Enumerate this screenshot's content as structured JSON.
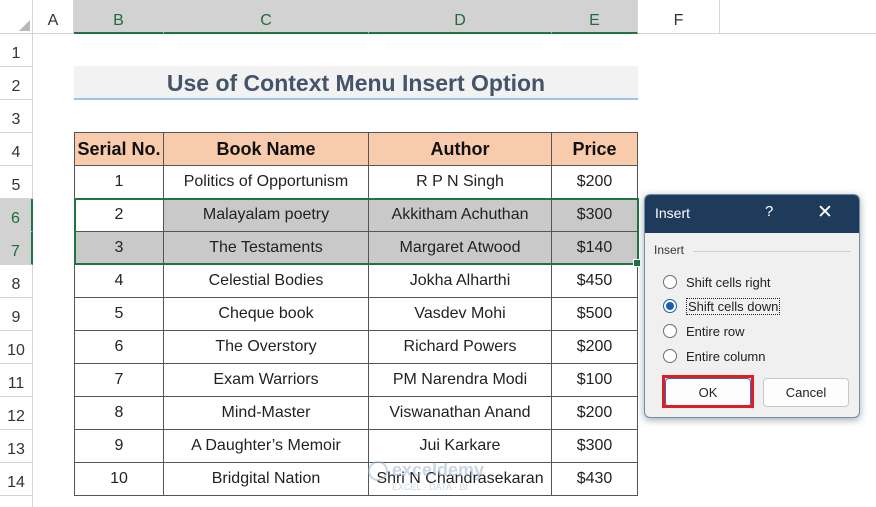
{
  "sheet": {
    "columns": [
      "A",
      "B",
      "C",
      "D",
      "E",
      "F"
    ],
    "rows": [
      "1",
      "2",
      "3",
      "4",
      "5",
      "6",
      "7",
      "8",
      "9",
      "10",
      "11",
      "12",
      "13",
      "14"
    ],
    "title": "Use  of Context Menu Insert Option",
    "headers": [
      "Serial No.",
      "Book Name",
      "Author",
      "Price"
    ],
    "data": [
      [
        "1",
        "Politics of Opportunism",
        "R P N Singh",
        "$200"
      ],
      [
        "2",
        "Malayalam poetry",
        "Akkitham Achuthan",
        "$300"
      ],
      [
        "3",
        "The Testaments",
        "Margaret Atwood",
        "$140"
      ],
      [
        "4",
        "Celestial Bodies",
        "Jokha Alharthi",
        "$450"
      ],
      [
        "5",
        "Cheque book",
        "Vasdev Mohi",
        "$500"
      ],
      [
        "6",
        "The Overstory",
        "Richard Powers",
        "$200"
      ],
      [
        "7",
        "Exam Warriors",
        "PM Narendra Modi",
        "$100"
      ],
      [
        "8",
        "Mind-Master",
        "Viswanathan Anand",
        "$200"
      ],
      [
        "9",
        "A Daughter’s Memoir",
        "Jui Karkare",
        "$300"
      ],
      [
        "10",
        "Bridgital Nation",
        "Shri N Chandrasekaran",
        "$430"
      ]
    ],
    "selected_rows": [
      "6",
      "7"
    ],
    "selected_columns": [
      "B",
      "C",
      "D",
      "E"
    ]
  },
  "watermark": {
    "name": "exceldemy",
    "tagline": "EXCEL · DATA · BI"
  },
  "dialog": {
    "title": "Insert",
    "help_icon": "?",
    "close_icon": "✕",
    "group_label": "Insert",
    "options": [
      {
        "label": "Shift cells right",
        "selected": false
      },
      {
        "label": "Shift cells down",
        "selected": true
      },
      {
        "label": "Entire row",
        "selected": false
      },
      {
        "label": "Entire column",
        "selected": false
      }
    ],
    "ok_label": "OK",
    "cancel_label": "Cancel"
  },
  "colors": {
    "header_fill": "#f8cbad",
    "selection_fill": "#c9c9c9",
    "selection_border": "#217346",
    "dialog_titlebar": "#1f3b5c",
    "highlight": "#e31b23"
  }
}
